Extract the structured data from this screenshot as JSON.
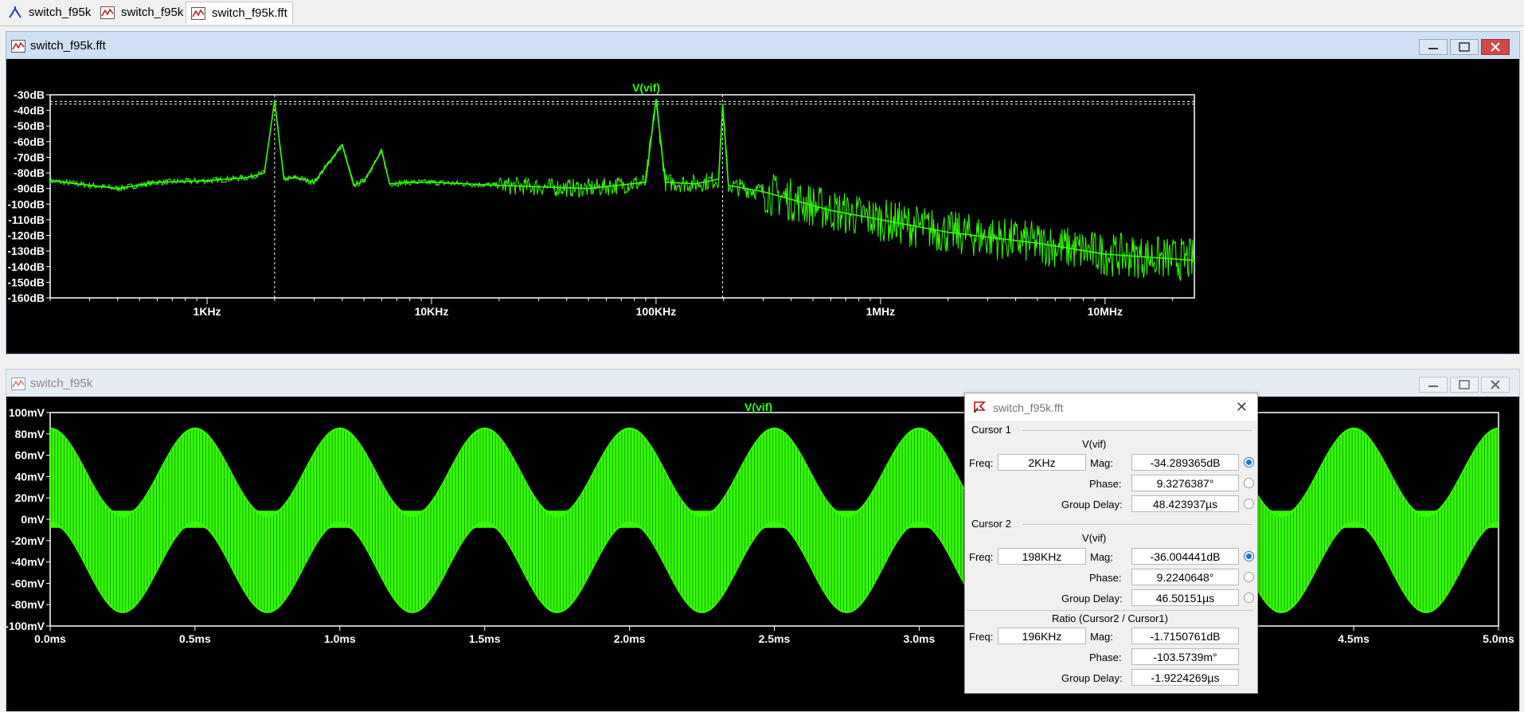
{
  "tabs": [
    {
      "label": "switch_f95k",
      "icon": "schematic-icon"
    },
    {
      "label": "switch_f95k",
      "icon": "waveform-icon"
    },
    {
      "label": "switch_f95k.fft",
      "icon": "waveform-icon"
    }
  ],
  "fft_window": {
    "title": "switch_f95k.fft",
    "trace_label": "V(vif)",
    "colors": {
      "trace": "#33ff00",
      "background": "#000000",
      "axis": "#ffffff"
    }
  },
  "time_window": {
    "title": "switch_f95k",
    "trace_label": "V(vif)"
  },
  "chart_data": [
    {
      "type": "line",
      "title": "V(vif)",
      "xscale": "log",
      "xlim": [
        200,
        25000000
      ],
      "ylim": [
        -160,
        -30
      ],
      "y_ticks": [
        "-30dB",
        "-40dB",
        "-50dB",
        "-60dB",
        "-70dB",
        "-80dB",
        "-90dB",
        "-100dB",
        "-110dB",
        "-120dB",
        "-130dB",
        "-140dB",
        "-150dB",
        "-160dB"
      ],
      "x_ticks": [
        "1KHz",
        "10KHz",
        "100KHz",
        "1MHz",
        "10MHz"
      ],
      "x_tick_values": [
        1000,
        10000,
        100000,
        1000000,
        10000000
      ],
      "cursors": [
        2000,
        198000
      ],
      "series": [
        {
          "name": "V(vif)",
          "x": [
            200,
            400,
            600,
            1000,
            1500,
            1800,
            2000,
            2200,
            2500,
            3000,
            4000,
            4500,
            5000,
            6000,
            6500,
            8000,
            10000,
            20000,
            50000,
            90000,
            100000,
            110000,
            150000,
            190000,
            198000,
            210000,
            300000,
            400000,
            600000,
            1000000,
            2000000,
            5000000,
            10000000,
            25000000
          ],
          "y": [
            -85,
            -90,
            -86,
            -85,
            -83,
            -80,
            -34,
            -84,
            -83,
            -86,
            -62,
            -88,
            -85,
            -66,
            -87,
            -86,
            -86,
            -88,
            -90,
            -86,
            -33,
            -86,
            -87,
            -84,
            -36,
            -88,
            -92,
            -97,
            -104,
            -110,
            -118,
            -125,
            -132,
            -136
          ]
        }
      ]
    },
    {
      "type": "line",
      "title": "V(vif)",
      "xlim": [
        0,
        5
      ],
      "ylim": [
        -100,
        100
      ],
      "x_ticks": [
        "0.0ms",
        "0.5ms",
        "1.0ms",
        "1.5ms",
        "2.0ms",
        "2.5ms",
        "3.0ms",
        "3.5ms",
        "4.0ms",
        "4.5ms",
        "5.0ms"
      ],
      "y_ticks": [
        "100mV",
        "80mV",
        "60mV",
        "40mV",
        "20mV",
        "0mV",
        "-20mV",
        "-40mV",
        "-60mV",
        "-80mV",
        "-100mV"
      ],
      "series": [
        {
          "name": "V(vif)",
          "envelope_max_mV": 82,
          "envelope_min_mV": -84,
          "cycles_per_ms": 2
        }
      ]
    }
  ],
  "cursor_dialog": {
    "title": "switch_f95k.fft",
    "cursor1": {
      "heading": "Cursor 1",
      "trace": "V(vif)",
      "freq_label": "Freq:",
      "freq": "2KHz",
      "mag_label": "Mag:",
      "mag": "-34.289365dB",
      "phase_label": "Phase:",
      "phase": "9.3276387°",
      "gd_label": "Group Delay:",
      "group_delay": "48.423937µs"
    },
    "cursor2": {
      "heading": "Cursor 2",
      "trace": "V(vif)",
      "freq_label": "Freq:",
      "freq": "198KHz",
      "mag_label": "Mag:",
      "mag": "-36.004441dB",
      "phase_label": "Phase:",
      "phase": "9.2240648°",
      "gd_label": "Group Delay:",
      "group_delay": "46.50151µs"
    },
    "ratio": {
      "heading": "Ratio (Cursor2 / Cursor1)",
      "freq_label": "Freq:",
      "freq": "196KHz",
      "mag_label": "Mag:",
      "mag": "-1.7150761dB",
      "phase_label": "Phase:",
      "phase": "-103.5739m°",
      "gd_label": "Group Delay:",
      "group_delay": "-1.9224269µs"
    }
  }
}
